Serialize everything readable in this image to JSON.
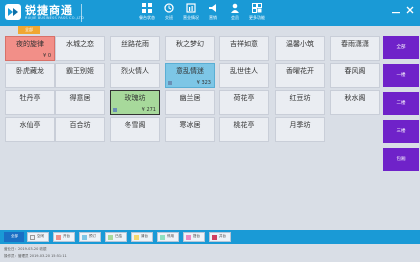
{
  "header": {
    "brand": "锐捷商通",
    "brand_sub": "RUIJIE BUSINESS PASS CO.,LTD",
    "nav": [
      {
        "label": "餐台状态",
        "icon": "grid-icon"
      },
      {
        "label": "交班",
        "icon": "handover-icon"
      },
      {
        "label": "营业情况",
        "icon": "report-icon"
      },
      {
        "label": "营销",
        "icon": "marketing-icon"
      },
      {
        "label": "会员",
        "icon": "member-icon"
      },
      {
        "label": "更多功能",
        "icon": "more-icon"
      }
    ],
    "controls": {
      "minimize": "minimize-icon",
      "close": "close-icon"
    }
  },
  "tabs": {
    "active": "全部"
  },
  "tables": [
    {
      "name": "夜的旋律",
      "status": "occupied",
      "amount": "¥ 0"
    },
    {
      "name": "水城之恋",
      "status": "free"
    },
    {
      "name": "丝路花雨",
      "status": "free"
    },
    {
      "name": "秋之梦幻",
      "status": "free"
    },
    {
      "name": "吉祥如意",
      "status": "free"
    },
    {
      "name": "温馨小筑",
      "status": "free"
    },
    {
      "name": "春雨潇潇",
      "status": "free"
    },
    {
      "name": "卧虎藏龙",
      "status": "free"
    },
    {
      "name": "霸王别姬",
      "status": "free"
    },
    {
      "name": "烈火情人",
      "status": "free"
    },
    {
      "name": "意乱情迷",
      "status": "reserved",
      "amount": "¥ 323"
    },
    {
      "name": "乱世佳人",
      "status": "free"
    },
    {
      "name": "香曜花开",
      "status": "free"
    },
    {
      "name": "春风阁",
      "status": "free"
    },
    {
      "name": "牡丹亭",
      "status": "free"
    },
    {
      "name": "得意居",
      "status": "free"
    },
    {
      "name": "玫瑰坊",
      "status": "selected",
      "amount": "¥ 271"
    },
    {
      "name": "幽兰居",
      "status": "free"
    },
    {
      "name": "荷花亭",
      "status": "free"
    },
    {
      "name": "红豆坊",
      "status": "free"
    },
    {
      "name": "秋水阁",
      "status": "free"
    },
    {
      "name": "水仙亭",
      "status": "free"
    },
    {
      "name": "百合坊",
      "status": "free"
    },
    {
      "name": "冬雪阁",
      "status": "free"
    },
    {
      "name": "寒冰居",
      "status": "free"
    },
    {
      "name": "桃花亭",
      "status": "free"
    },
    {
      "name": "月季坊",
      "status": "free"
    }
  ],
  "actions": [
    "全部",
    "一楼",
    "二楼",
    "三楼",
    "包厢"
  ],
  "legend": [
    {
      "label": "全部",
      "color": "#1a6fc4"
    },
    {
      "label": "空闲",
      "color": "#eaedf2"
    },
    {
      "label": "开台",
      "color": "#f28f88"
    },
    {
      "label": "预订",
      "color": "#7dc6e6"
    },
    {
      "label": "已结",
      "color": "#a7d99b"
    },
    {
      "label": "清台",
      "color": "#f5d76e"
    },
    {
      "label": "停用",
      "color": "#8ee0c0"
    },
    {
      "label": "搭台",
      "color": "#f08ac0"
    },
    {
      "label": "并台",
      "color": "#d04060"
    }
  ],
  "footer": {
    "line1": "营业日：2019-03-20    收银",
    "line2": "操作员：管理员    2019-03-20  15:51:11"
  }
}
